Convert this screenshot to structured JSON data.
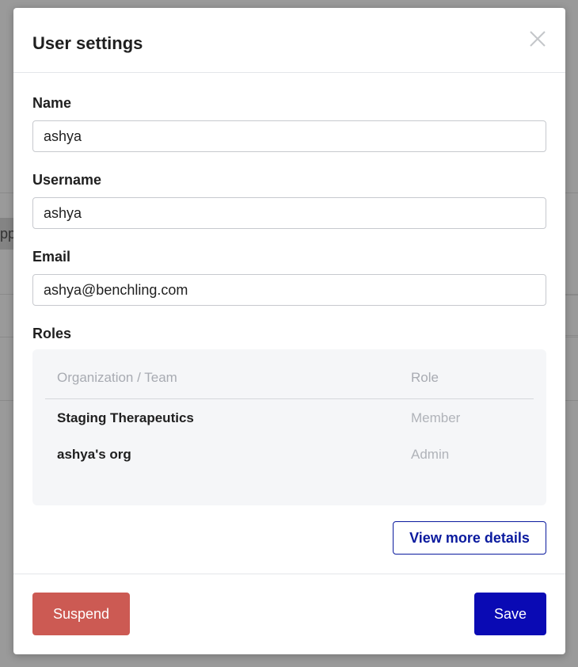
{
  "background": {
    "partial_text": "pp"
  },
  "modal": {
    "title": "User settings",
    "close_icon": "close-icon",
    "fields": {
      "name": {
        "label": "Name",
        "value": "ashya"
      },
      "username": {
        "label": "Username",
        "value": "ashya"
      },
      "email": {
        "label": "Email",
        "value": "ashya@benchling.com"
      }
    },
    "roles": {
      "label": "Roles",
      "columns": [
        "Organization / Team",
        "Role"
      ],
      "rows": [
        {
          "org": "Staging Therapeutics",
          "role": "Member"
        },
        {
          "org": "ashya's org",
          "role": "Admin"
        }
      ]
    },
    "details_button": "View more details",
    "footer": {
      "suspend_label": "Suspend",
      "save_label": "Save"
    }
  },
  "colors": {
    "primary": "#0a0ab4",
    "danger": "#cc5a53",
    "outline_accent": "#0a1a9e"
  }
}
